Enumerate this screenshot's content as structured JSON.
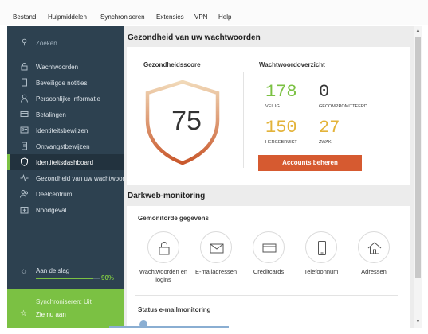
{
  "menubar": {
    "items": [
      "Bestand",
      "Hulpmiddelen",
      "Synchroniseren",
      "Extensies",
      "VPN",
      "Help"
    ]
  },
  "sidebar": {
    "search_label": "Zoeken...",
    "items": [
      {
        "label": "Wachtwoorden",
        "icon": "lock-icon"
      },
      {
        "label": "Beveiligde notities",
        "icon": "note-icon"
      },
      {
        "label": "Persoonlijke informatie",
        "icon": "person-icon"
      },
      {
        "label": "Betalingen",
        "icon": "card-icon"
      },
      {
        "label": "Identiteitsbewijzen",
        "icon": "id-card-icon"
      },
      {
        "label": "Ontvangstbewijzen",
        "icon": "receipt-icon"
      },
      {
        "label": "Identiteitsdashboard",
        "icon": "shield-icon",
        "active": true
      },
      {
        "label": "Gezondheid van uw wachtwoord",
        "icon": "pulse-icon"
      },
      {
        "label": "Deelcentrum",
        "icon": "share-icon"
      },
      {
        "label": "Noodgeval",
        "icon": "emergency-icon"
      }
    ],
    "getting_started": {
      "label": "Aan de slag",
      "percent_text": "90%",
      "progress": 0.9
    },
    "sync": {
      "status": "Synchroniseren: Uit",
      "later": "Zie nu aan"
    }
  },
  "health": {
    "section_title": "Gezondheid van uw wachtwoorden",
    "score_title": "Gezondheidsscore",
    "score": "75",
    "overview_title": "Wachtwoordoverzicht",
    "stats": [
      {
        "value": "178",
        "label": "Veilig",
        "color": "#7bc143"
      },
      {
        "value": "0",
        "label": "Gecompromitteerd",
        "color": "#333333"
      },
      {
        "value": "150",
        "label": "Hergebruikt",
        "color": "#e3b33a"
      },
      {
        "value": "27",
        "label": "Zwak",
        "color": "#e3b33a"
      }
    ],
    "manage_button": "Accounts beheren",
    "accent_color": "#d65a30"
  },
  "darkweb": {
    "section_title": "Darkweb-monitoring",
    "monitored_title": "Gemonitorde gegevens",
    "items": [
      {
        "label": "Wachtwoorden en logins",
        "icon": "padlock-icon"
      },
      {
        "label": "E-mailadressen",
        "icon": "envelope-icon"
      },
      {
        "label": "Creditcards",
        "icon": "credit-card-icon"
      },
      {
        "label": "Telefoonnum",
        "icon": "phone-icon"
      },
      {
        "label": "Adressen",
        "icon": "house-icon"
      }
    ],
    "email_status_title": "Status e-mailmonitoring"
  }
}
